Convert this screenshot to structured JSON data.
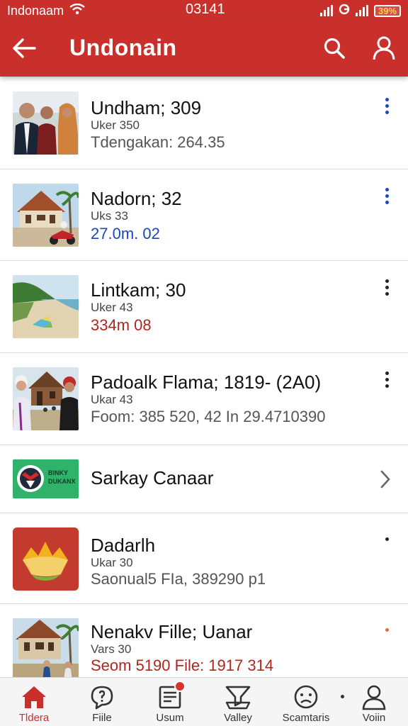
{
  "status_bar": {
    "carrier": "Indonaam",
    "time": "03141",
    "battery": "39%"
  },
  "app_bar": {
    "title": "Undonain"
  },
  "colors": {
    "brand": "#c9302c",
    "blue": "#1a47b8",
    "red": "#b0251c",
    "orange": "#e0703a"
  },
  "items": [
    {
      "title": "Undham; 309",
      "sub": "Uker 350",
      "meta": "Tdengakan: 264.35",
      "meta_color": "gray",
      "action": "more-icon",
      "action_color": "#1a47b8"
    },
    {
      "title": "Nadorn;  32",
      "sub": "Uks 33",
      "meta": "27.0m. 02",
      "meta_color": "blue",
      "action": "more-icon",
      "action_color": "#1a47b8"
    },
    {
      "title": "Lintkam;  30",
      "sub": "Uker 43",
      "meta": "334m  08",
      "meta_color": "red",
      "action": "more-icon",
      "action_color": "#222222"
    },
    {
      "title": "Padoalk Flama; 1819- (2A0)",
      "sub": "Ukar 43",
      "meta": "Foom: 385 520, 42 In 29.4710390",
      "meta_color": "gray",
      "action": "more-icon",
      "action_color": "#222222"
    },
    {
      "title": "Sarkay Canaar",
      "action": "chevron-right-icon",
      "logo_text_1": "BINKY",
      "logo_text_2": "DUKANX"
    },
    {
      "title": "Dadarlh",
      "sub": "Ukar 30",
      "meta": "Saonual5 FIa, 389290  p1",
      "meta_color": "gray",
      "action": "dot-icon",
      "action_color": "#222222"
    },
    {
      "title": "Nenakv Fille; Uanar",
      "sub": "Vars 30",
      "meta": "Seom 5190 File: 1917 314",
      "meta_color": "red",
      "action": "dot-icon",
      "action_color": "#e0703a"
    }
  ],
  "bottom_nav": [
    {
      "label": "Tldera",
      "icon": "home-icon",
      "active": true
    },
    {
      "label": "Fiile",
      "icon": "chat-icon",
      "active": false
    },
    {
      "label": "Usum",
      "icon": "document-icon",
      "active": false,
      "badge": true
    },
    {
      "label": "Valley",
      "icon": "funnel-icon",
      "active": false
    },
    {
      "label": "Scamtaris",
      "icon": "face-icon",
      "active": false
    },
    {
      "label": "Voiin",
      "icon": "person-icon",
      "active": false
    }
  ]
}
